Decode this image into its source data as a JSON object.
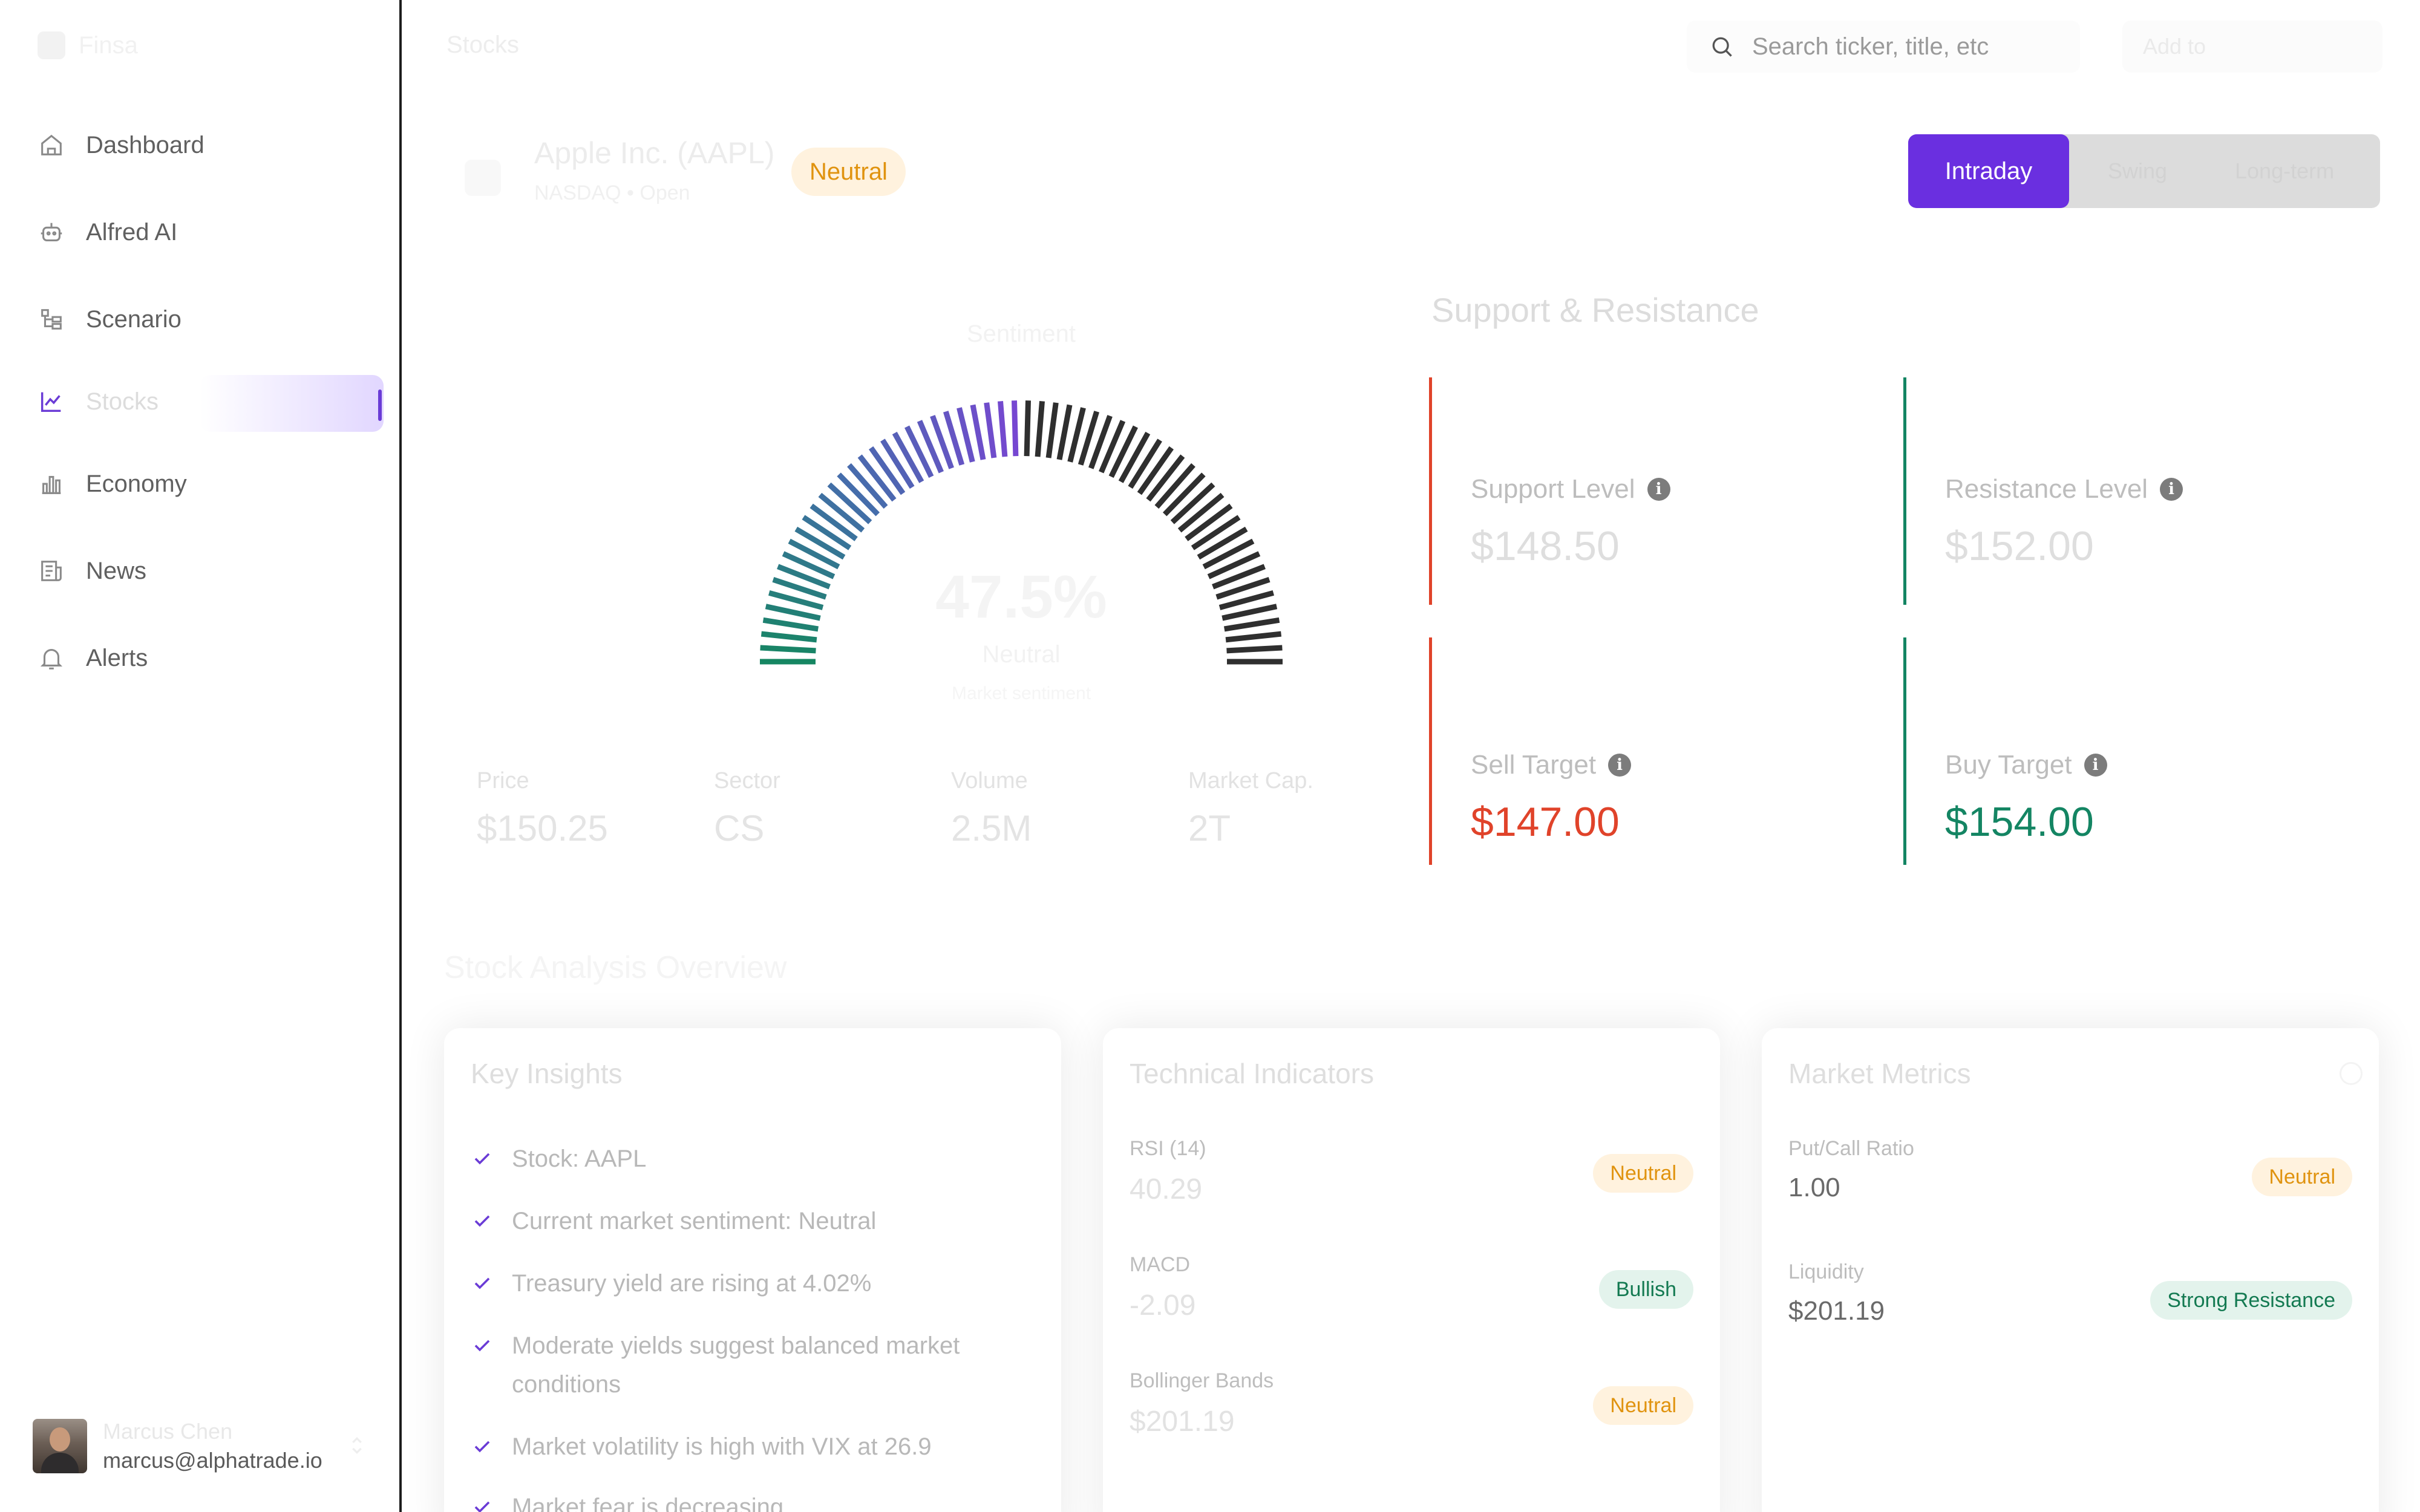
{
  "sidebar": {
    "logo_text": "Finsa",
    "items": [
      {
        "label": "Dashboard",
        "icon": "home-icon"
      },
      {
        "label": "Alfred AI",
        "icon": "robot-icon"
      },
      {
        "label": "Scenario",
        "icon": "scenario-icon"
      },
      {
        "label": "Stocks",
        "icon": "chart-line-icon",
        "active": true
      },
      {
        "label": "Economy",
        "icon": "bar-chart-icon"
      },
      {
        "label": "News",
        "icon": "newspaper-icon"
      },
      {
        "label": "Alerts",
        "icon": "bell-icon"
      }
    ],
    "user": {
      "name": "Marcus Chen",
      "email": "marcus@alphatrade.io"
    }
  },
  "header": {
    "breadcrumb": "Stocks",
    "search_placeholder": "Search ticker, title, etc",
    "action_label": "Add to"
  },
  "ticker": {
    "name": "Apple Inc. (AAPL)",
    "subtitle": "NASDAQ • Open",
    "sentiment_badge": "Neutral"
  },
  "timeframe": {
    "options": [
      "Intraday",
      "Swing",
      "Long-term"
    ],
    "selected": "Intraday"
  },
  "gauge": {
    "title": "Sentiment",
    "value": "47.5%",
    "label": "Neutral",
    "subtitle": "Market sentiment",
    "fraction": 0.5
  },
  "stats": [
    {
      "label": "Price",
      "value": "$150.25"
    },
    {
      "label": "Sector",
      "value": "CS"
    },
    {
      "label": "Volume",
      "value": "2.5M"
    },
    {
      "label": "Market Cap.",
      "value": "2T"
    }
  ],
  "support_resistance": {
    "title": "Support & Resistance",
    "support": {
      "label": "Support Level",
      "value": "$148.50"
    },
    "resistance": {
      "label": "Resistance Level",
      "value": "$152.00"
    },
    "sell": {
      "label": "Sell Target",
      "value": "$147.00"
    },
    "buy": {
      "label": "Buy Target",
      "value": "$154.00"
    }
  },
  "analysis_title": "Stock Analysis Overview",
  "key_insights": {
    "title": "Key Insights",
    "items": [
      "Stock: AAPL",
      "Current market sentiment: Neutral",
      "Treasury yield are rising at 4.02%",
      "Moderate yields suggest balanced market conditions",
      "Market volatility is high with VIX at 26.9",
      "Market fear is decreasing"
    ]
  },
  "technical": {
    "title": "Technical Indicators",
    "rows": [
      {
        "label": "RSI (14)",
        "value": "40.29",
        "badge": "Neutral"
      },
      {
        "label": "MACD",
        "value": "-2.09",
        "badge": "Bullish"
      },
      {
        "label": "Bollinger Bands",
        "value": "$201.19",
        "badge": "Neutral"
      }
    ]
  },
  "market_metrics": {
    "title": "Market Metrics",
    "rows": [
      {
        "label": "Put/Call Ratio",
        "value": "1.00",
        "badge": "Neutral"
      },
      {
        "label": "Liquidity",
        "value": "$201.19",
        "badge": "Strong Resistance"
      }
    ]
  },
  "colors": {
    "accent": "#6a2fe0",
    "red": "#e0432a",
    "green": "#148563",
    "neutral_badge": "#e0930f"
  }
}
